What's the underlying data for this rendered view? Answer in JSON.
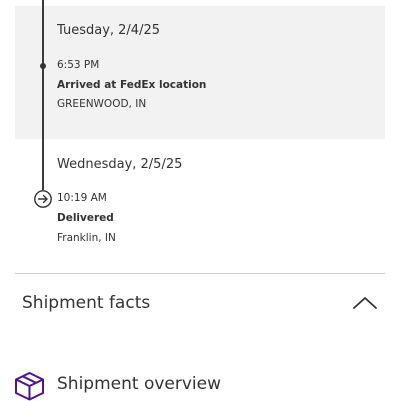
{
  "tracking": {
    "events": [
      {
        "date": "Tuesday, 2/4/25",
        "time": "6:53 PM",
        "status": "Arrived at FedEx location",
        "location": "GREENWOOD, IN"
      },
      {
        "date": "Wednesday, 2/5/25",
        "time": "10:19 AM",
        "status": "Delivered",
        "location": "Franklin, IN"
      }
    ]
  },
  "sections": {
    "shipment_facts": "Shipment facts",
    "shipment_overview": "Shipment overview"
  },
  "colors": {
    "brand_purple": "#4d148c",
    "timeline": "#3a3a3a",
    "highlight_bg": "#f2f2f2"
  },
  "icons": {
    "delivered": "circle-arrow-right-icon",
    "collapse": "chevron-up-icon",
    "overview": "package-box-icon"
  }
}
